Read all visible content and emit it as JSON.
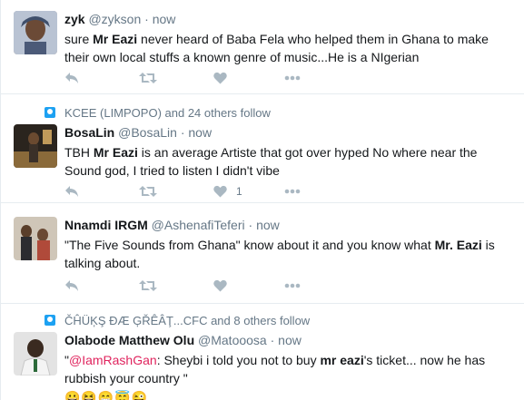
{
  "tweets": [
    {
      "name": "zyk",
      "handle": "@zykson",
      "time": "now",
      "text_before": "sure ",
      "text_bold": "Mr Eazi",
      "text_after": " never heard of Baba Fela who helped them in Ghana to make their own local stuffs a known genre of music...He is a NIgerian",
      "avatar_colors": [
        "#6f7f96",
        "#c9b19b"
      ]
    },
    {
      "follow_text": "KCEE (LIMPOPO) and 24 others follow",
      "name": "BosaLin",
      "handle": "@BosaLin",
      "time": "now",
      "text_before": "TBH ",
      "text_bold": "Mr Eazi",
      "text_after": " is an average Artiste that got over hyped No where near the Sound god, I tried to listen I didn't vibe",
      "like_count": "1",
      "avatar_colors": [
        "#2c2620",
        "#9a7a4a"
      ]
    },
    {
      "name": "Nnamdi IRGM",
      "handle": "@AshenafiTeferi",
      "time": "now",
      "text_before": "\"The Five Sounds from Ghana\" know about it and you know what ",
      "text_bold": "Mr. Eazi",
      "text_after": " is talking about.",
      "avatar_colors": [
        "#5a4a3a",
        "#b08a6a"
      ]
    },
    {
      "follow_text": "ČĤÜĶŞ ÐÆ ĢŘÊÂŢ...CFC and 8 others follow",
      "name": "Olabode Matthew Olu",
      "handle": "@Matooosa",
      "time": "now",
      "mention": "@IamRashGan",
      "text_before": ": Sheybi  i told you not to buy ",
      "text_bold": "mr eazi",
      "text_after": "'s ticket... now he has rubbish your country \"",
      "emojis": "😀😆😁😇😜",
      "avatar_colors": [
        "#d9d9d9",
        "#3a2a20"
      ]
    }
  ],
  "separator": " · ",
  "action_icons": [
    "reply-icon",
    "retweet-icon",
    "like-icon",
    "more-icon"
  ]
}
